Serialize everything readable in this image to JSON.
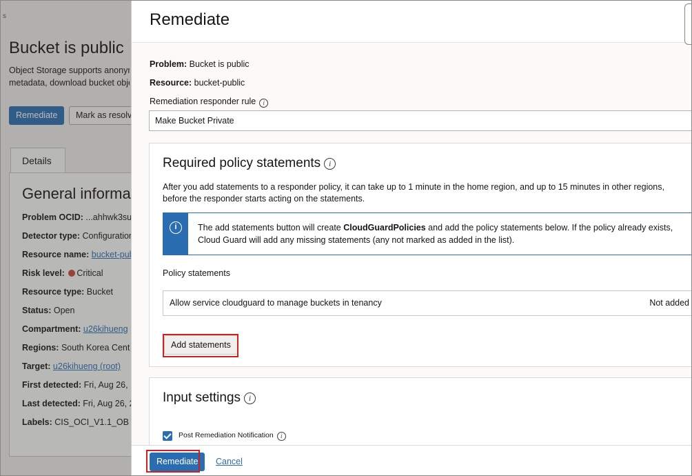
{
  "background": {
    "edge_label": "s",
    "title": "Bucket is public",
    "description_lines": [
      "Object Storage supports anonym",
      "metadata, download bucket obje"
    ],
    "remediate_button": "Remediate",
    "mark_resolved_button": "Mark as resolv",
    "tab_details": "Details",
    "panel_title": "General informat",
    "rows": [
      {
        "label": "Problem OCID:",
        "value": "...ahhwk3su"
      },
      {
        "label": "Detector type:",
        "value": "Configuration"
      },
      {
        "label": "Resource name:",
        "value": "bucket-publ"
      },
      {
        "label": "Risk level:",
        "value": "Critical"
      },
      {
        "label": "Resource type:",
        "value": "Bucket"
      },
      {
        "label": "Status:",
        "value": "Open"
      },
      {
        "label": "Compartment:",
        "value": "u26kihueng"
      },
      {
        "label": "Regions:",
        "value": "South Korea Cent"
      },
      {
        "label": "Target:",
        "value": "u26kihueng (root)"
      },
      {
        "label": "First detected:",
        "value": "Fri, Aug 26,"
      },
      {
        "label": "Last detected:",
        "value": "Fri, Aug 26, 2"
      },
      {
        "label": "Labels:",
        "value": "CIS_OCI_V1.1_OB"
      }
    ]
  },
  "panel": {
    "title": "Remediate",
    "problem_label": "Problem:",
    "problem_value": "Bucket is public",
    "resource_label": "Resource:",
    "resource_value": "bucket-public",
    "rule_label": "Remediation responder rule",
    "rule_value": "Make Bucket Private",
    "policy_card": {
      "title": "Required policy statements",
      "description": "After you add statements to a responder policy, it can take up to 1 minute in the home region, and up to 15 minutes in other regions, before the responder starts acting on the statements.",
      "notice_before": "The add statements button will create ",
      "notice_bold": "CloudGuardPolicies",
      "notice_after": " and add the policy statements below. If the policy already exists, Cloud Guard will add any missing statements (any not marked as added in the list).",
      "statements_label": "Policy statements",
      "statements": [
        {
          "text": "Allow service cloudguard to manage buckets in tenancy",
          "status": "Not added"
        }
      ],
      "add_button": "Add statements"
    },
    "input_card": {
      "title": "Input settings",
      "checkbox_label": "Post Remediation Notification",
      "checkbox_checked": true
    },
    "footer": {
      "primary": "Remediate",
      "cancel": "Cancel"
    }
  },
  "colors": {
    "accent": "#2b6db1",
    "highlight": "#d0201e",
    "critical": "#c74634"
  },
  "icons": {
    "info": "info-icon",
    "checkbox": "checkbox-checked-icon"
  }
}
